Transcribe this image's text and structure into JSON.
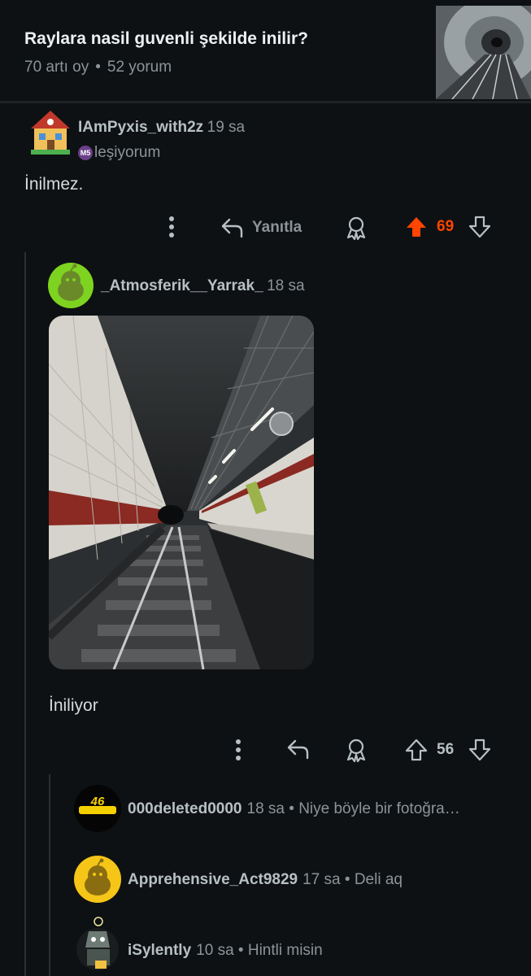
{
  "post": {
    "title": "Raylara nasil guvenli şekilde inilir?",
    "upvotes": "70 artı oy",
    "separator": "•",
    "comments": "52 yorum"
  },
  "comment1": {
    "username": "IAmPyxis_with2z",
    "time": "19 sa",
    "flair_badge": "M5",
    "flair": "leşiyorum",
    "body": "İnilmez.",
    "reply_label": "Yanıtla",
    "score": "69",
    "score_color": "#ff4500"
  },
  "comment2": {
    "username": "_Atmosferik__Yarrak_",
    "time": "18 sa",
    "body": "İniliyor",
    "score": "56"
  },
  "replies": [
    {
      "username": "000deleted0000",
      "time": "18 sa",
      "separator": "•",
      "text": "Niye böyle bir fotoğra…"
    },
    {
      "username": "Apprehensive_Act9829",
      "time": "17 sa",
      "separator": "•",
      "text": "Deli aq"
    },
    {
      "username": "iSylently",
      "time": "10 sa",
      "separator": "•",
      "text": "Hintli misin"
    }
  ],
  "avatar1_badge": "46"
}
